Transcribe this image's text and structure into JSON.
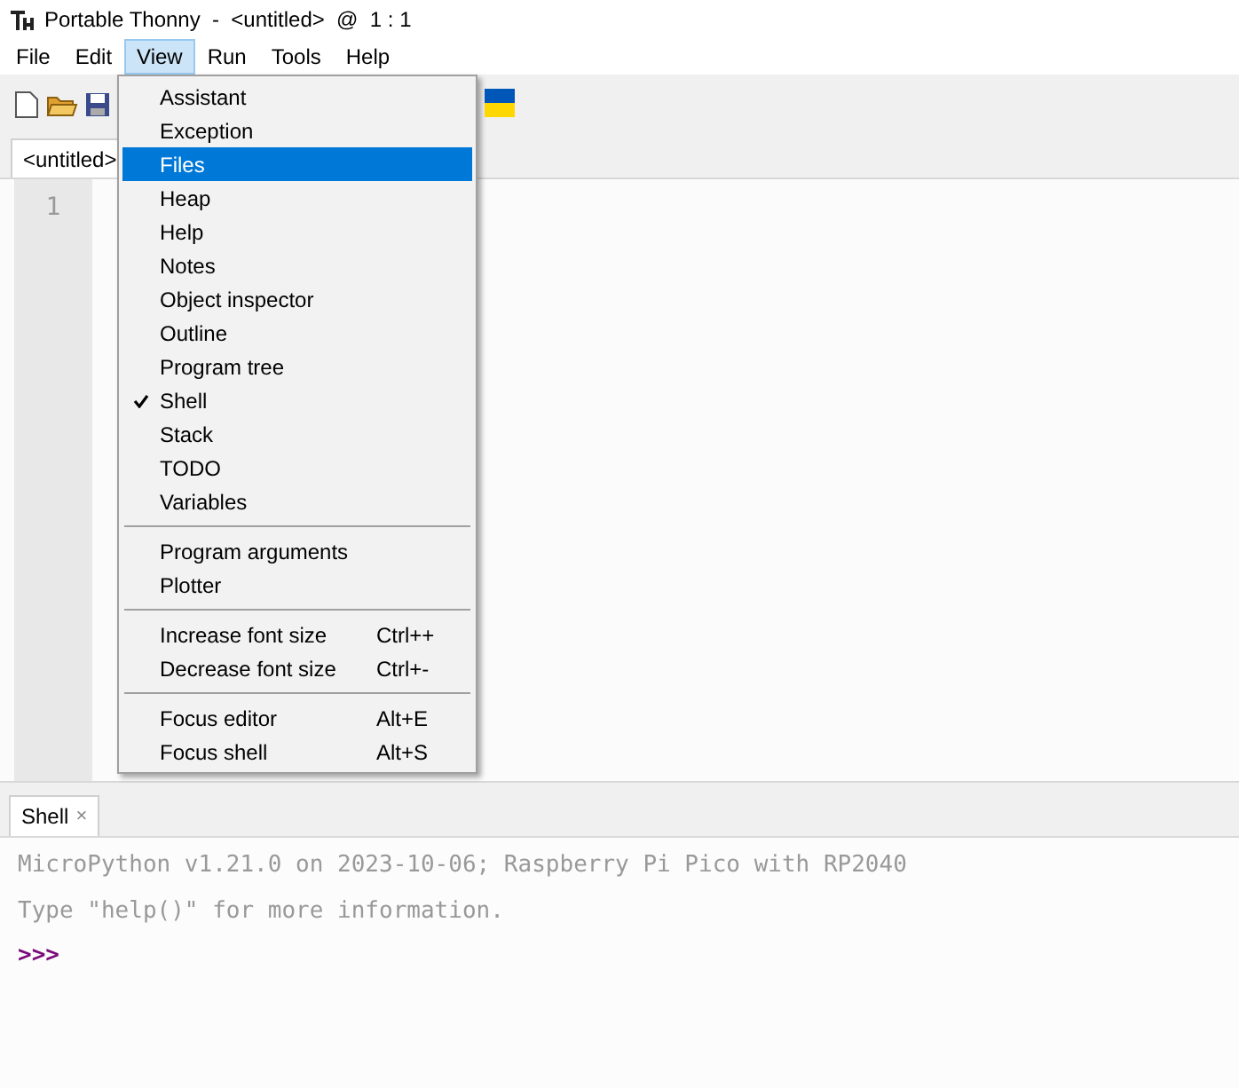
{
  "window": {
    "title": "Portable Thonny  -  <untitled>  @  1 : 1"
  },
  "menubar": [
    {
      "label": "File",
      "selected": false
    },
    {
      "label": "Edit",
      "selected": false
    },
    {
      "label": "View",
      "selected": true
    },
    {
      "label": "Run",
      "selected": false
    },
    {
      "label": "Tools",
      "selected": false
    },
    {
      "label": "Help",
      "selected": false
    }
  ],
  "editor": {
    "tab": "<untitled>",
    "line_numbers": [
      "1"
    ]
  },
  "view_menu": [
    {
      "kind": "item",
      "label": "Assistant",
      "checked": false,
      "selected": false
    },
    {
      "kind": "item",
      "label": "Exception",
      "checked": false,
      "selected": false
    },
    {
      "kind": "item",
      "label": "Files",
      "checked": false,
      "selected": true
    },
    {
      "kind": "item",
      "label": "Heap",
      "checked": false,
      "selected": false
    },
    {
      "kind": "item",
      "label": "Help",
      "checked": false,
      "selected": false
    },
    {
      "kind": "item",
      "label": "Notes",
      "checked": false,
      "selected": false
    },
    {
      "kind": "item",
      "label": "Object inspector",
      "checked": false,
      "selected": false
    },
    {
      "kind": "item",
      "label": "Outline",
      "checked": false,
      "selected": false
    },
    {
      "kind": "item",
      "label": "Program tree",
      "checked": false,
      "selected": false
    },
    {
      "kind": "item",
      "label": "Shell",
      "checked": true,
      "selected": false
    },
    {
      "kind": "item",
      "label": "Stack",
      "checked": false,
      "selected": false
    },
    {
      "kind": "item",
      "label": "TODO",
      "checked": false,
      "selected": false
    },
    {
      "kind": "item",
      "label": "Variables",
      "checked": false,
      "selected": false
    },
    {
      "kind": "separator"
    },
    {
      "kind": "item",
      "label": "Program arguments",
      "checked": false,
      "selected": false
    },
    {
      "kind": "item",
      "label": "Plotter",
      "checked": false,
      "selected": false
    },
    {
      "kind": "separator"
    },
    {
      "kind": "item",
      "label": "Increase font size",
      "shortcut": "Ctrl++",
      "checked": false,
      "selected": false
    },
    {
      "kind": "item",
      "label": "Decrease font size",
      "shortcut": "Ctrl+-",
      "checked": false,
      "selected": false
    },
    {
      "kind": "separator"
    },
    {
      "kind": "item",
      "label": "Focus editor",
      "shortcut": "Alt+E",
      "checked": false,
      "selected": false
    },
    {
      "kind": "item",
      "label": "Focus shell",
      "shortcut": "Alt+S",
      "checked": false,
      "selected": false
    }
  ],
  "shell": {
    "tab": "Shell",
    "close": "×",
    "lines": [
      {
        "kind": "output",
        "text": "MicroPython v1.21.0 on 2023-10-06; Raspberry Pi Pico with RP2040"
      },
      {
        "kind": "output",
        "text": "Type \"help()\" for more information."
      },
      {
        "kind": "prompt",
        "text": ">>>"
      }
    ]
  }
}
